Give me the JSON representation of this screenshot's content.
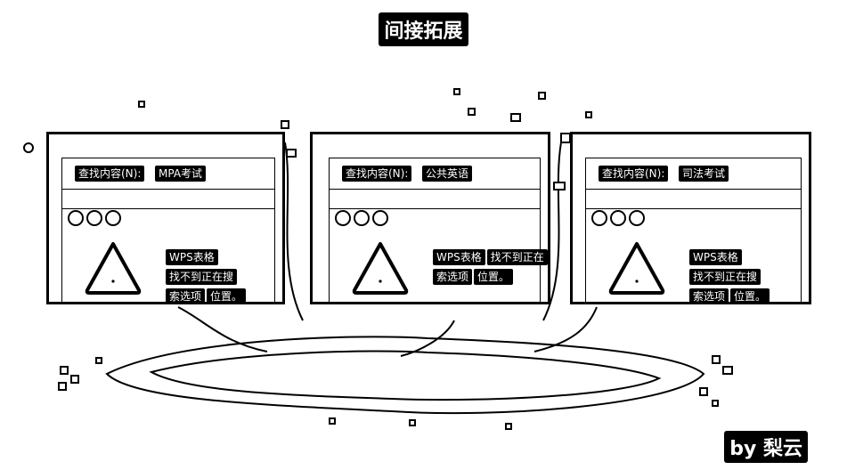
{
  "title": "间接拓展",
  "byline": "by 梨云",
  "cards": [
    {
      "find_label": "查找内容(N):",
      "search_value": "MPA考试",
      "message_parts": [
        "WPS表格",
        "找不到正在搜",
        "索选项",
        "位置。"
      ]
    },
    {
      "find_label": "查找内容(N):",
      "search_value": "公共英语",
      "message_parts": [
        "WPS表格",
        "找不到正在",
        "索选项",
        "位置。"
      ]
    },
    {
      "find_label": "查找内容(N):",
      "search_value": "司法考试",
      "message_parts": [
        "WPS表格",
        "找不到正在搜",
        "索选项",
        "位置。"
      ]
    }
  ],
  "icons": {
    "warning": "warning-triangle-icon",
    "radio": "circle-icon"
  }
}
